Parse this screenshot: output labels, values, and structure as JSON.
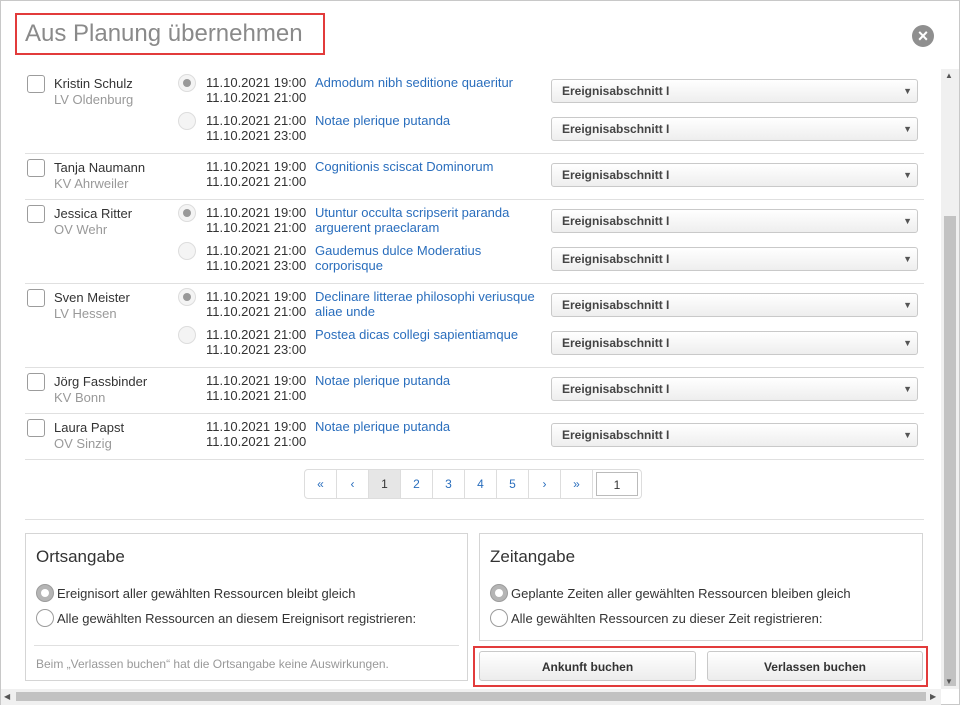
{
  "dialog": {
    "title": "Aus Planung übernehmen",
    "close_icon": "close-icon"
  },
  "rows": [
    {
      "name": "Kristin Schulz",
      "org": "LV Oldenburg",
      "slots": [
        {
          "selected": true,
          "start": "11.10.2021 19:00",
          "end": "11.10.2021 21:00",
          "event": "Admodum nibh seditione quaeritur",
          "section": "Ereignisabschnitt I"
        },
        {
          "selected": false,
          "start": "11.10.2021 21:00",
          "end": "11.10.2021 23:00",
          "event": "Notae plerique putanda",
          "section": "Ereignisabschnitt I"
        }
      ]
    },
    {
      "name": "Tanja Naumann",
      "org": "KV Ahrweiler",
      "slots": [
        {
          "selected": null,
          "start": "11.10.2021 19:00",
          "end": "11.10.2021 21:00",
          "event": "Cognitionis sciscat Dominorum",
          "section": "Ereignisabschnitt I"
        }
      ]
    },
    {
      "name": "Jessica Ritter",
      "org": "OV Wehr",
      "slots": [
        {
          "selected": true,
          "start": "11.10.2021 19:00",
          "end": "11.10.2021 21:00",
          "event": "Utuntur occulta scripserit paranda arguerent praeclaram",
          "section": "Ereignisabschnitt I"
        },
        {
          "selected": false,
          "start": "11.10.2021 21:00",
          "end": "11.10.2021 23:00",
          "event": "Gaudemus dulce Moderatius corporisque",
          "section": "Ereignisabschnitt I"
        }
      ]
    },
    {
      "name": "Sven Meister",
      "org": "LV Hessen",
      "slots": [
        {
          "selected": true,
          "start": "11.10.2021 19:00",
          "end": "11.10.2021 21:00",
          "event": "Declinare litterae philosophi veriusque aliae unde",
          "section": "Ereignisabschnitt I"
        },
        {
          "selected": false,
          "start": "11.10.2021 21:00",
          "end": "11.10.2021 23:00",
          "event": "Postea dicas collegi sapientiamque",
          "section": "Ereignisabschnitt I"
        }
      ]
    },
    {
      "name": "Jörg Fassbinder",
      "org": "KV Bonn",
      "slots": [
        {
          "selected": null,
          "start": "11.10.2021 19:00",
          "end": "11.10.2021 21:00",
          "event": "Notae plerique putanda",
          "section": "Ereignisabschnitt I"
        }
      ]
    },
    {
      "name": "Laura Papst",
      "org": "OV Sinzig",
      "slots": [
        {
          "selected": null,
          "start": "11.10.2021 19:00",
          "end": "11.10.2021 21:00",
          "event": "Notae plerique putanda",
          "section": "Ereignisabschnitt I"
        }
      ]
    }
  ],
  "pagination": {
    "first": "«",
    "prev": "‹",
    "pages": [
      "1",
      "2",
      "3",
      "4",
      "5"
    ],
    "active": "1",
    "next": "›",
    "last": "»",
    "page_input": "1"
  },
  "location": {
    "heading": "Ortsangabe",
    "option1": "Ereignisort aller gewählten Ressourcen bleibt gleich",
    "option2": "Alle gewählten Ressourcen an diesem Ereignisort registrieren:",
    "note": "Beim „Verlassen buchen“ hat die Ortsangabe keine Auswirkungen."
  },
  "time": {
    "heading": "Zeitangabe",
    "option1": "Geplante Zeiten aller gewählten Ressourcen bleiben gleich",
    "option2": "Alle gewählten Ressourcen zu dieser Zeit registrieren:"
  },
  "buttons": {
    "arrival": "Ankunft buchen",
    "leave": "Verlassen buchen"
  },
  "colors": {
    "link": "#2a6ebd",
    "highlight": "#e23b3b"
  }
}
